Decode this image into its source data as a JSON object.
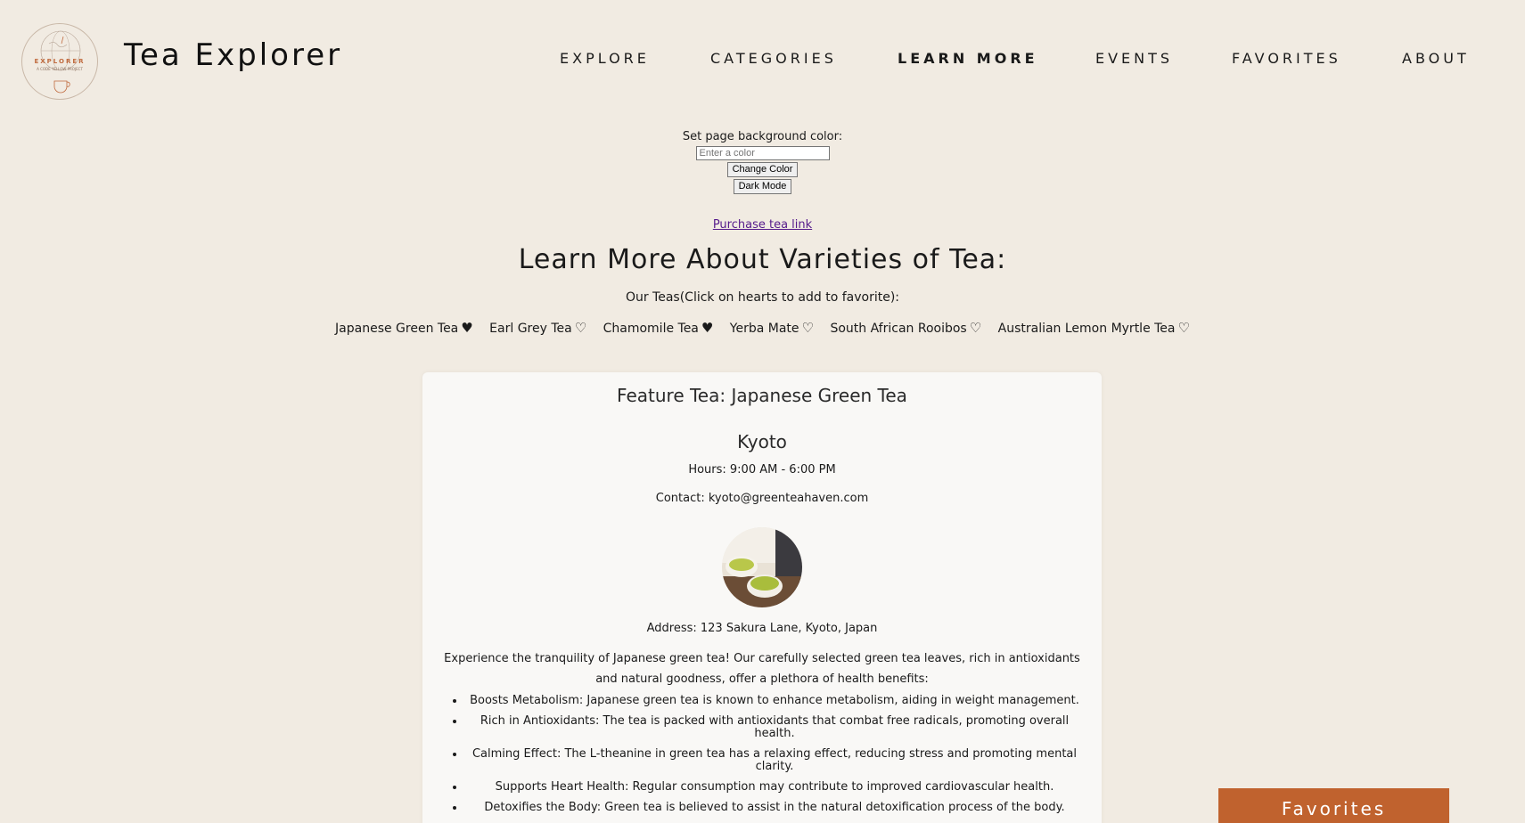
{
  "header": {
    "logo": {
      "name": "EXPLORER",
      "subtitle": "A CODE YELLOW PROJECT"
    },
    "title": "Tea Explorer",
    "nav": [
      {
        "label": "EXPLORE",
        "active": false
      },
      {
        "label": "CATEGORIES",
        "active": false
      },
      {
        "label": "LEARN MORE",
        "active": true
      },
      {
        "label": "EVENTS",
        "active": false
      },
      {
        "label": "FAVORITES",
        "active": false
      },
      {
        "label": "ABOUT",
        "active": false
      }
    ]
  },
  "controls": {
    "label": "Set page background color:",
    "color_placeholder": "Enter a color",
    "color_value": "",
    "change_button": "Change Color",
    "dark_button": "Dark Mode"
  },
  "purchase_link": "Purchase tea link",
  "heading": "Learn More About Varieties of Tea:",
  "teas_label": "Our Teas(Click on hearts to add to favorite):",
  "teas": [
    {
      "name": "Japanese Green Tea",
      "favorite": true
    },
    {
      "name": "Earl Grey Tea",
      "favorite": false
    },
    {
      "name": "Chamomile Tea",
      "favorite": true
    },
    {
      "name": "Yerba Mate",
      "favorite": false
    },
    {
      "name": "South African Rooibos",
      "favorite": false
    },
    {
      "name": "Australian Lemon Myrtle Tea",
      "favorite": false
    }
  ],
  "feature": {
    "title": "Feature Tea: Japanese Green Tea",
    "city": "Kyoto",
    "hours": "Hours: 9:00 AM - 6:00 PM",
    "contact": "Contact: kyoto@greenteahaven.com",
    "address": "Address: 123 Sakura Lane, Kyoto, Japan",
    "intro": "Experience the tranquility of Japanese green tea! Our carefully selected green tea leaves, rich in antioxidants and natural goodness, offer a plethora of health benefits:",
    "benefits": [
      "Boosts Metabolism: Japanese green tea is known to enhance metabolism, aiding in weight management.",
      "Rich in Antioxidants: The tea is packed with antioxidants that combat free radicals, promoting overall health.",
      "Calming Effect: The L-theanine in green tea has a relaxing effect, reducing stress and promoting mental clarity.",
      "Supports Heart Health: Regular consumption may contribute to improved cardiovascular health.",
      "Detoxifies the Body: Green tea is believed to assist in the natural detoxification process of the body."
    ]
  },
  "favorites_button": "Favorites",
  "colors": {
    "background": "#f1ebe2",
    "card": "#f9f8f6",
    "accent": "#c0622e",
    "link": "#551a8b"
  },
  "icons": {
    "heart_filled": "♥",
    "heart_empty": "♡"
  }
}
